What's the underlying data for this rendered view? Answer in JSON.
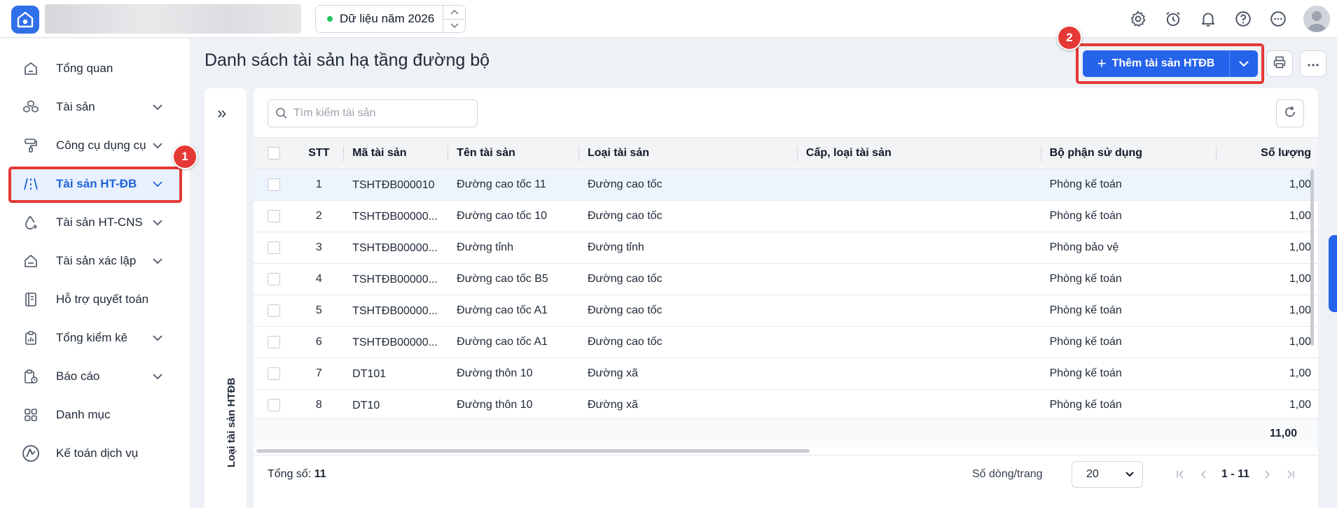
{
  "topbar": {
    "year_label": "Dữ liệu năm 2026",
    "icons": [
      "settings-icon",
      "alarm-clock-icon",
      "bell-icon",
      "help-icon",
      "more-icon",
      "avatar"
    ]
  },
  "sidebar": {
    "items": [
      {
        "label": "Tổng quan",
        "icon": "home-icon",
        "has_children": false
      },
      {
        "label": "Tài sản",
        "icon": "cubes-icon",
        "has_children": true
      },
      {
        "label": "Công cụ dụng cụ",
        "icon": "paint-roller-icon",
        "has_children": true
      },
      {
        "label": "Tài sản HT-ĐB",
        "icon": "road-icon",
        "has_children": true,
        "active": true
      },
      {
        "label": "Tài sản HT-CNS",
        "icon": "water-drop-icon",
        "has_children": true
      },
      {
        "label": "Tài sản xác lập",
        "icon": "house-icon",
        "has_children": true
      },
      {
        "label": "Hỗ trợ quyết toán",
        "icon": "notebook-icon",
        "has_children": false
      },
      {
        "label": "Tổng kiểm kê",
        "icon": "clipboard-icon",
        "has_children": true
      },
      {
        "label": "Báo cáo",
        "icon": "report-icon",
        "has_children": true
      },
      {
        "label": "Danh mục",
        "icon": "grid-icon",
        "has_children": false
      },
      {
        "label": "Kế toán dịch vụ",
        "icon": "service-logo-icon",
        "has_children": false
      }
    ]
  },
  "annotations": {
    "badge1": "1",
    "badge2": "2"
  },
  "header": {
    "title": "Danh sách tài sản hạ tầng đường bộ",
    "add_button": "Thêm tài sản HTĐB"
  },
  "filter_panel": {
    "label": "Loại tài sản HTĐB"
  },
  "search": {
    "placeholder": "Tìm kiếm tài sản"
  },
  "table": {
    "columns": [
      "STT",
      "Mã tài sản",
      "Tên tài sản",
      "Loại tài sản",
      "Cấp, loại tài sản",
      "Bộ phận sử dụng",
      "Số lượng"
    ],
    "rows": [
      {
        "stt": "1",
        "ma": "TSHTĐB000010",
        "ten": "Đường cao tốc 11",
        "loai": "Đường cao tốc",
        "cap": "",
        "bp": "Phòng kế toán",
        "sl": "1,00"
      },
      {
        "stt": "2",
        "ma": "TSHTĐB00000...",
        "ten": "Đường cao tốc 10",
        "loai": "Đường cao tốc",
        "cap": "",
        "bp": "Phòng kế toán",
        "sl": "1,00"
      },
      {
        "stt": "3",
        "ma": "TSHTĐB00000...",
        "ten": "Đường tỉnh",
        "loai": "Đường tỉnh",
        "cap": "",
        "bp": "Phòng bảo vệ",
        "sl": "1,00"
      },
      {
        "stt": "4",
        "ma": "TSHTĐB00000...",
        "ten": "Đường cao tốc B5",
        "loai": "Đường cao tốc",
        "cap": "",
        "bp": "Phòng kế toán",
        "sl": "1,00"
      },
      {
        "stt": "5",
        "ma": "TSHTĐB00000...",
        "ten": "Đường cao tốc A1",
        "loai": "Đường cao tốc",
        "cap": "",
        "bp": "Phòng kế toán",
        "sl": "1,00"
      },
      {
        "stt": "6",
        "ma": "TSHTĐB00000...",
        "ten": "Đường cao tốc A1",
        "loai": "Đường cao tốc",
        "cap": "",
        "bp": "Phòng kế toán",
        "sl": "1,00"
      },
      {
        "stt": "7",
        "ma": "DT101",
        "ten": "Đường thôn 10",
        "loai": "Đường xã",
        "cap": "",
        "bp": "Phòng kế toán",
        "sl": "1,00"
      },
      {
        "stt": "8",
        "ma": "DT10",
        "ten": "Đường thôn 10",
        "loai": "Đường xã",
        "cap": "",
        "bp": "Phòng kế toán",
        "sl": "1,00"
      }
    ],
    "total_quantity": "11,00"
  },
  "footer": {
    "total_label": "Tổng số:",
    "total_value": "11",
    "rows_per_page_label": "Số dòng/trang",
    "rows_per_page": "20",
    "range": "1 - 11"
  },
  "colors": {
    "accent": "#2563eb",
    "highlight": "#e53935",
    "active_bg": "#e8f0fe"
  }
}
